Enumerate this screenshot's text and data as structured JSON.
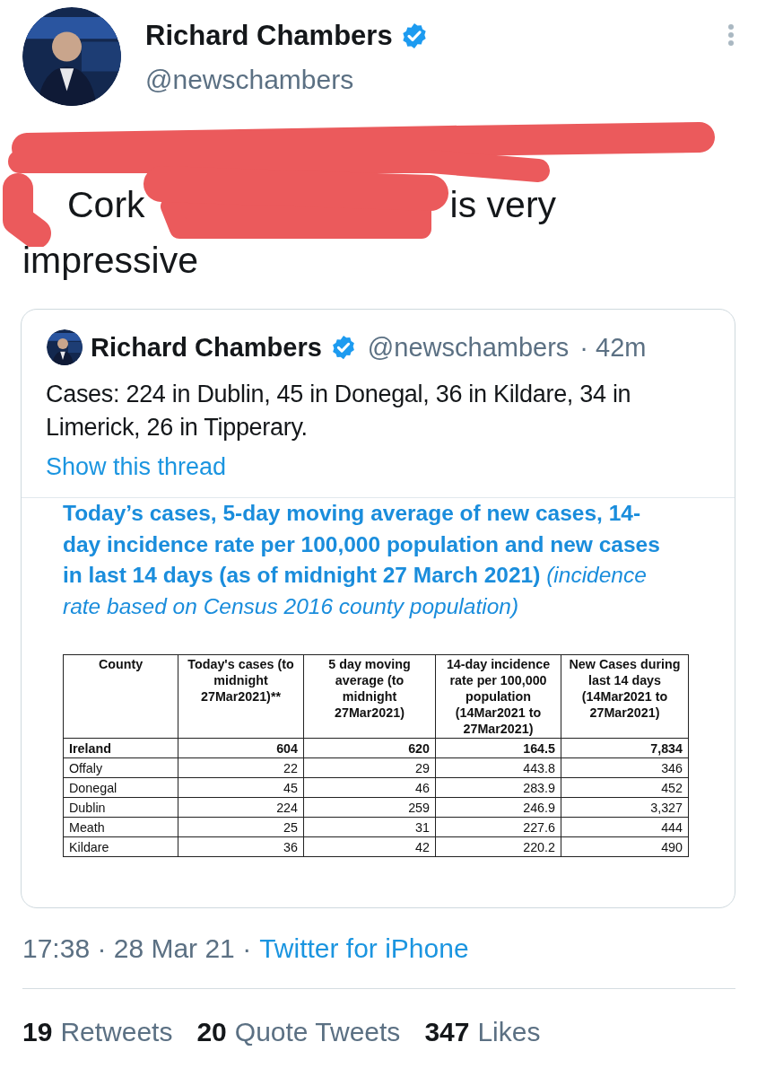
{
  "tweet": {
    "author": {
      "name": "Richard Chambers",
      "handle": "@newschambers",
      "verified": true
    },
    "text_fragments": [
      "Cork",
      "is very",
      "impressive"
    ]
  },
  "quoted_tweet": {
    "author": {
      "name": "Richard Chambers",
      "handle": "@newschambers",
      "verified": true
    },
    "time": "· 42m",
    "text": "Cases: 224 in Dublin, 45 in Donegal, 36 in Kildare, 34 in Limerick, 26 in Tipperary.",
    "thread_link": "Show this thread",
    "image": {
      "title": "**Today’s cases, 5-day moving average of new cases, 14-day incidence rate per 100,000 population and new cases in last 14 days (as of midnight 27 March 2021)** *(incidence rate based on Census 2016 county population)*",
      "table": {
        "columns": [
          "County",
          "Today's cases (to midnight 27Mar2021)**",
          "5 day moving average (to midnight 27Mar2021)",
          "14-day incidence rate per 100,000 population (14Mar2021 to 27Mar2021)",
          "New Cases during last 14 days (14Mar2021 to 27Mar2021)"
        ],
        "rows": [
          {
            "total": true,
            "cells": [
              "Ireland",
              "604",
              "620",
              "164.5",
              "7,834"
            ]
          },
          {
            "total": false,
            "cells": [
              "Offaly",
              "22",
              "29",
              "443.8",
              "346"
            ]
          },
          {
            "total": false,
            "cells": [
              "Donegal",
              "45",
              "46",
              "283.9",
              "452"
            ]
          },
          {
            "total": false,
            "cells": [
              "Dublin",
              "224",
              "259",
              "246.9",
              "3,327"
            ]
          },
          {
            "total": false,
            "cells": [
              "Meath",
              "25",
              "31",
              "227.6",
              "444"
            ]
          },
          {
            "total": false,
            "cells": [
              "Kildare",
              "36",
              "42",
              "220.2",
              "490"
            ]
          }
        ]
      }
    }
  },
  "meta": {
    "time": "17:38 · 28 Mar 21 ·",
    "source": "Twitter for iPhone"
  },
  "stats": [
    {
      "count": "19",
      "label": "Retweets"
    },
    {
      "count": "20",
      "label": "Quote Tweets"
    },
    {
      "count": "347",
      "label": "Likes"
    }
  ]
}
